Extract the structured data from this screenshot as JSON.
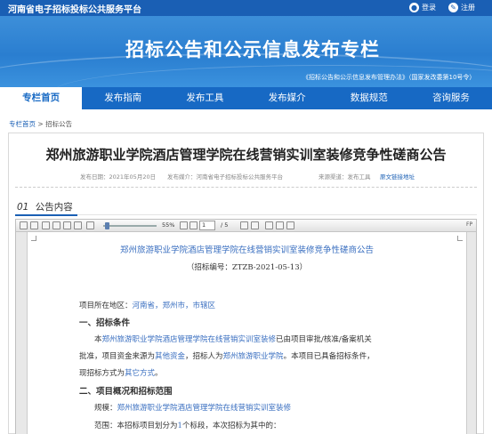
{
  "topbar": {
    "site_name": "河南省电子招标投标公共服务平台",
    "login": "登录",
    "register": "注册"
  },
  "banner": {
    "title": "招标公告和公示信息发布专栏",
    "note": "《招标公告和公示信息发布管理办法》（国家发改委第10号令）"
  },
  "nav": {
    "items": [
      "专栏首页",
      "发布指南",
      "发布工具",
      "发布媒介",
      "数据规范",
      "咨询服务"
    ]
  },
  "breadcrumb": {
    "home": "专栏首页",
    "separator": ">",
    "current": "招标公告"
  },
  "article": {
    "title": "郑州旅游职业学院酒店管理学院在线营销实训室装修竞争性磋商公告",
    "meta": {
      "publish_date": "发布日期：2021年05月20日",
      "media": "发布媒介：河南省电子招标投标公共服务平台",
      "source": "来源渠道：发布工具",
      "original_link": "原文链接地址"
    }
  },
  "section": {
    "number": "01",
    "label": "公告内容"
  },
  "viewer": {
    "zoom": "55%",
    "page_current": "1",
    "page_total": "/ 5",
    "fp_label": "FP",
    "doc": {
      "title": "郑州旅游职业学院酒店管理学院在线营销实训室装修竞争性磋商公告",
      "code": "（招标编号：ZTZB-2021-05-13）",
      "location_label": "项目所在地区：",
      "location_value": "河南省，郑州市，市辖区",
      "h_conditions": "一、招标条件",
      "cond_1": "本",
      "cond_project": "郑州旅游职业学院酒店管理学院在线营销实训室装修",
      "cond_2": "已由项目审批/核准/备案机关",
      "cond_3": "批准，项目资金来源为",
      "cond_funds": "其他资金",
      "cond_4": "，招标人为",
      "cond_tenderer": "郑州旅游职业学院",
      "cond_5": "。本项目已具备招标条件，",
      "cond_6": "现招标方式为",
      "cond_method": "其它方式",
      "cond_7": "。",
      "h_overview": "二、项目概况和招标范围",
      "scale_label": "规模：",
      "scale_value": "郑州旅游职业学院酒店管理学院在线营销实训室装修",
      "scope_1": "范围：本招标项目划分为",
      "scope_count": "1",
      "scope_2": "个标段，本次招标为其中的："
    }
  }
}
